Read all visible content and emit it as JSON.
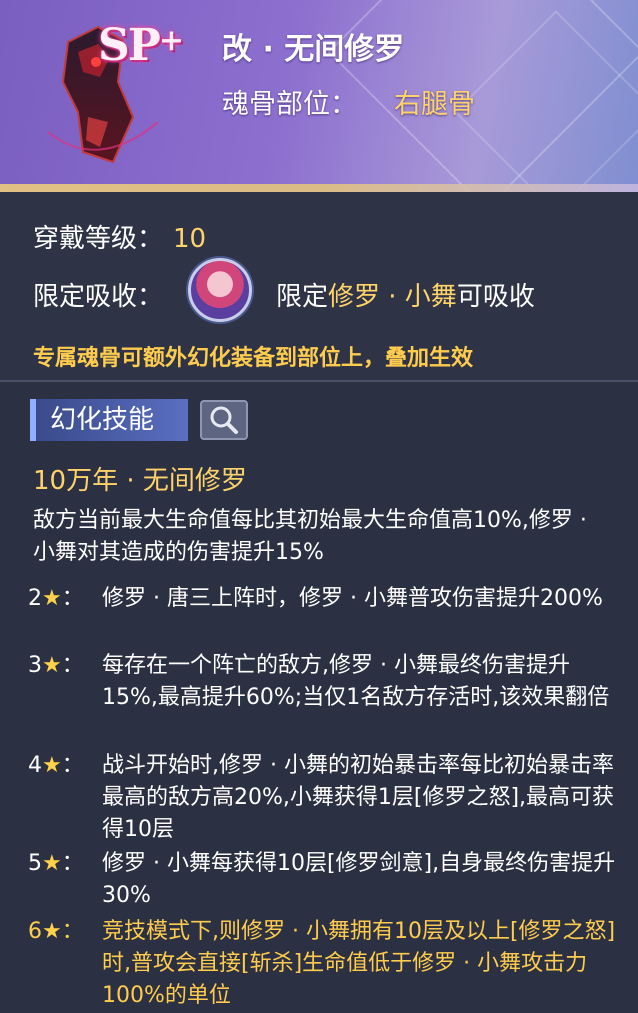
{
  "header": {
    "badge": "SP",
    "badge_plus": "+",
    "title": "改 · 无间修罗",
    "slot_label": "魂骨部位：",
    "slot_value": "右腿骨"
  },
  "info": {
    "level_label": "穿戴等级：",
    "level_value": "10",
    "absorb_label": "限定吸收：",
    "absorb_prefix": "限定",
    "absorb_name": "修罗 · 小舞",
    "absorb_suffix": "可吸收",
    "exclusive_note": "专属魂骨可额外幻化装备到部位上，叠加生效"
  },
  "skills": {
    "tab_label": "幻化技能",
    "skill_name": "10万年 · 无间修罗",
    "skill_desc": "敌方当前最大生命值每比其初始最大生命值高10%,修罗 · 小舞对其造成的伤害提升15%",
    "stars": [
      {
        "level": "2",
        "text": "修罗 · 唐三上阵时，修罗 · 小舞普攻伤害提升200%"
      },
      {
        "level": "3",
        "text": "每存在一个阵亡的敌方,修罗 · 小舞最终伤害提升15%,最高提升60%;当仅1名敌方存活时,该效果翻倍"
      },
      {
        "level": "4",
        "text": "战斗开始时,修罗 · 小舞的初始暴击率每比初始暴击率最高的敌方高20%,小舞获得1层[修罗之怒],最高可获得10层"
      },
      {
        "level": "5",
        "text": "修罗 · 小舞每获得10层[修罗剑意],自身最终伤害提升30%"
      },
      {
        "level": "6",
        "text": "竞技模式下,则修罗 · 小舞拥有10层及以上[修罗之怒]时,普攻会直接[斩杀]生命值低于修罗 · 小舞攻击力100%的单位"
      }
    ],
    "star_glyph": "★",
    "star_sep": "："
  },
  "colors": {
    "gold": "#ffd36a",
    "highlight": "#ffcc4d",
    "panel_bg": "#2b3142",
    "header_purple": "#8d6fcf"
  }
}
